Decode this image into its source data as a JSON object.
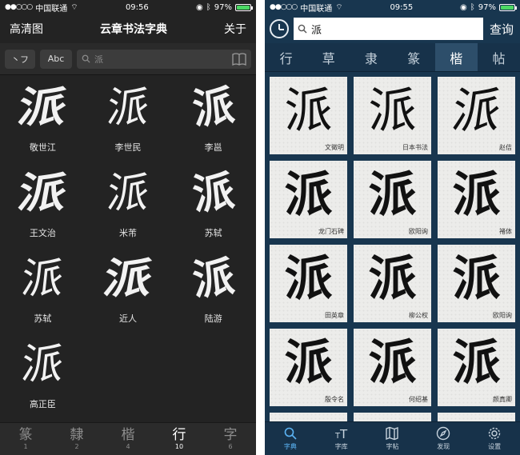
{
  "left": {
    "status": {
      "carrier": "中国联通",
      "time": "09:56",
      "battery": "97%"
    },
    "nav": {
      "left": "高清图",
      "title": "云章书法字典",
      "right": "关于"
    },
    "toolbar": {
      "pill_a": "丶フ",
      "pill_b": "Abc",
      "search_placeholder": "派"
    },
    "glyphs": [
      {
        "char": "派",
        "name": "敬世江"
      },
      {
        "char": "派",
        "name": "李世民"
      },
      {
        "char": "派",
        "name": "李邕"
      },
      {
        "char": "派",
        "name": "王文治"
      },
      {
        "char": "派",
        "name": "米芾"
      },
      {
        "char": "派",
        "name": "苏轼"
      },
      {
        "char": "派",
        "name": "苏轼"
      },
      {
        "char": "派",
        "name": "近人"
      },
      {
        "char": "派",
        "name": "陆游"
      },
      {
        "char": "派",
        "name": "高正臣"
      }
    ],
    "tabs": [
      {
        "glyph": "篆",
        "count": "1"
      },
      {
        "glyph": "隸",
        "count": "2"
      },
      {
        "glyph": "楷",
        "count": "4"
      },
      {
        "glyph": "行",
        "count": "10"
      },
      {
        "glyph": "字",
        "count": "6"
      }
    ]
  },
  "right": {
    "status": {
      "carrier": "中国联通",
      "time": "09:55",
      "battery": "97%"
    },
    "search_value": "派",
    "query_label": "查询",
    "tabs": [
      "行",
      "草",
      "隶",
      "篆",
      "楷",
      "帖"
    ],
    "glyphs": [
      {
        "char": "派",
        "name": "文徵明"
      },
      {
        "char": "派",
        "name": "日本书法"
      },
      {
        "char": "派",
        "name": "赵佶"
      },
      {
        "char": "派",
        "name": "龙门石碑"
      },
      {
        "char": "派",
        "name": "欧阳询"
      },
      {
        "char": "派",
        "name": "褚体"
      },
      {
        "char": "派",
        "name": "田英章"
      },
      {
        "char": "派",
        "name": "柳公权"
      },
      {
        "char": "派",
        "name": "欧阳询"
      },
      {
        "char": "派",
        "name": "殷令名"
      },
      {
        "char": "派",
        "name": "何绍基"
      },
      {
        "char": "派",
        "name": "颜真卿"
      }
    ],
    "bottom_tabs": [
      "字典",
      "字库",
      "字帖",
      "发现",
      "设置"
    ],
    "colors": {
      "accent": "#5bb4f5",
      "nav_bg": "#18364f"
    }
  }
}
